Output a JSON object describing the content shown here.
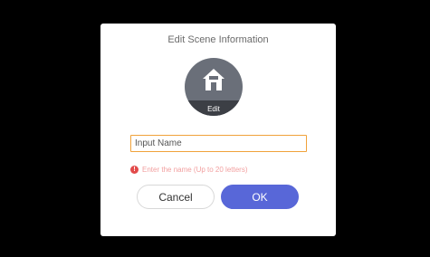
{
  "dialog": {
    "title": "Edit Scene Information",
    "avatar": {
      "icon": "house-icon",
      "edit_label": "Edit"
    },
    "name_input": {
      "value": "",
      "placeholder": "Input Name"
    },
    "error": {
      "icon": "error-icon",
      "text": "Enter the name (Up to 20 letters)"
    },
    "buttons": {
      "cancel_label": "Cancel",
      "ok_label": "OK"
    },
    "colors": {
      "accent": "#5867d8",
      "input_border": "#f0a23a",
      "error": "#e24a4a"
    }
  }
}
